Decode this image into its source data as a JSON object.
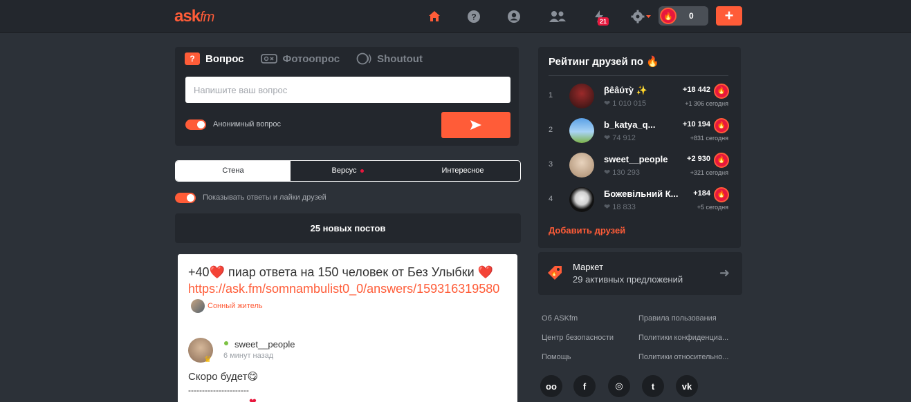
{
  "header": {
    "logo_main": "ask",
    "logo_fm": "fm",
    "notifications_badge": "21",
    "coins_count": "0",
    "add_label": "+"
  },
  "ask": {
    "tabs": [
      {
        "label": "Вопрос",
        "icon": "question-icon",
        "active": true
      },
      {
        "label": "Фотоопрос",
        "icon": "photopoll-icon",
        "active": false
      },
      {
        "label": "Shoutout",
        "icon": "shoutout-icon",
        "active": false
      }
    ],
    "placeholder": "Напишите ваш вопрос",
    "anonymous_label": "Анонимный вопрос"
  },
  "feed": {
    "tabs": [
      {
        "label": "Стена",
        "active": true
      },
      {
        "label": "Версус",
        "active": false,
        "dot": true
      },
      {
        "label": "Интересное",
        "active": false
      }
    ],
    "show_friends_label": "Показывать ответы и лайки друзей",
    "new_posts": "25 новых постов"
  },
  "post": {
    "title": "+40❤️ пиар ответа на 150 человек от Без Улыбки ❤️",
    "link": "https://ask.fm/somnambulist0_0/answers/159316319580",
    "asker_mood": "Сонный житель",
    "author": "sweet__people",
    "time": "6 минут назад",
    "answer": "Скоро будет😋",
    "divider": "----------------------"
  },
  "ranking": {
    "title": "Рейтинг друзей по 🔥",
    "rows": [
      {
        "rank": "1",
        "name": "βêâύτỳ ✨",
        "likes": "1 010 015",
        "points": "+18 442",
        "today": "+1 306 сегодня"
      },
      {
        "rank": "2",
        "name": "b_katya_q...",
        "likes": "74 912",
        "points": "+10 194",
        "today": "+831 сегодня"
      },
      {
        "rank": "3",
        "name": "sweet__people",
        "likes": "130 293",
        "points": "+2 930",
        "today": "+321 сегодня"
      },
      {
        "rank": "4",
        "name": "Божевільний К...",
        "likes": "18 833",
        "points": "+184",
        "today": "+5 сегодня"
      }
    ],
    "add_friends": "Добавить друзей"
  },
  "market": {
    "title": "Маркет",
    "subtitle": "29 активных предложений"
  },
  "footer": {
    "links": [
      "Об ASKfm",
      "Правила пользования",
      "Центр безопасности",
      "Политики конфиденциа...",
      "Помощь",
      "Политики относительно..."
    ],
    "social": [
      "ok-icon",
      "facebook-icon",
      "instagram-icon",
      "twitter-icon",
      "vk-icon"
    ],
    "social_labels": [
      "оо",
      "f",
      "◎",
      "t",
      "vk"
    ]
  },
  "colors": {
    "accent": "#ff5c38",
    "background": "#2c3138",
    "card": "#23272d",
    "danger": "#e8173d"
  }
}
